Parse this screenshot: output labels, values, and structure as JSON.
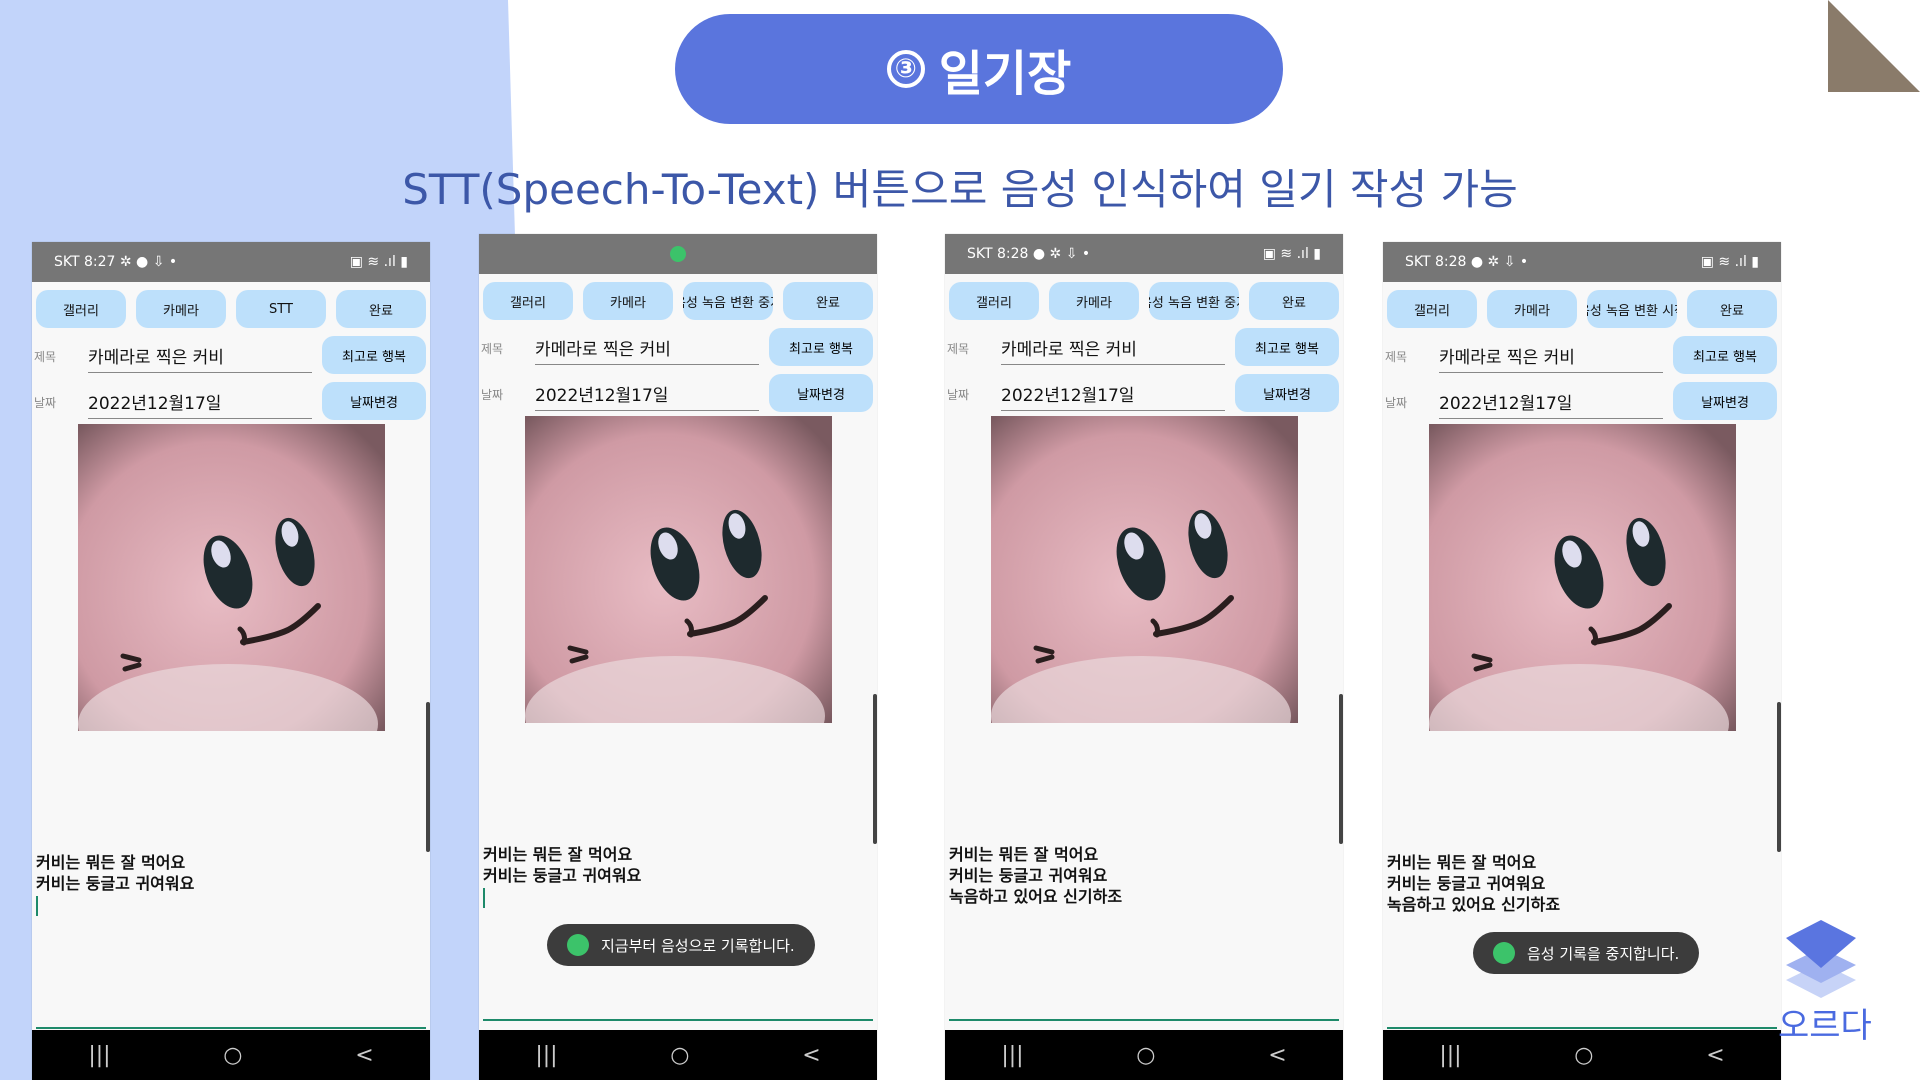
{
  "slide": {
    "step_number": "③",
    "title": "일기장",
    "subtitle": "STT(Speech-To-Text) 버튼으로 음성 인식하여 일기 작성 가능",
    "logo_text": "오르다"
  },
  "labels": {
    "title_label": "제목",
    "date_label": "날짜"
  },
  "nav": {
    "recent": "|||",
    "home": "○",
    "back": "<"
  },
  "phones": [
    {
      "status_left": "SKT 8:27 ✲ ● ⇩ •",
      "status_right": "▣ ≋ .ıl ▮",
      "buttons": [
        "갤러리",
        "카메라",
        "STT",
        "완료"
      ],
      "title_value": "카메라로 찍은 커비",
      "title_button": "최고로 행복",
      "date_value": "2022년12월17일",
      "date_button": "날짜변경",
      "notes": [
        "커비는 뭐든 잘 먹어요",
        "커비는 둥글고 귀여워요"
      ],
      "toast": ""
    },
    {
      "status_left": "",
      "status_right": "",
      "buttons": [
        "갤러리",
        "카메라",
        "음성 녹음 변환 중지",
        "완료"
      ],
      "title_value": "카메라로 찍은 커비",
      "title_button": "최고로 행복",
      "date_value": "2022년12월17일",
      "date_button": "날짜변경",
      "notes": [
        "커비는 뭐든 잘 먹어요",
        "커비는 둥글고 귀여워요"
      ],
      "toast": "지금부터 음성으로 기록합니다."
    },
    {
      "status_left": "SKT 8:28 ● ✲ ⇩ •",
      "status_right": "▣ ≋ .ıl ▮",
      "buttons": [
        "갤러리",
        "카메라",
        "음성 녹음 변환 중지",
        "완료"
      ],
      "title_value": "카메라로 찍은 커비",
      "title_button": "최고로 행복",
      "date_value": "2022년12월17일",
      "date_button": "날짜변경",
      "notes": [
        "커비는 뭐든 잘 먹어요",
        "커비는 둥글고 귀여워요",
        "녹음하고 있어요 신기하조"
      ],
      "toast": ""
    },
    {
      "status_left": "SKT 8:28 ● ✲ ⇩ •",
      "status_right": "▣ ≋ .ıl ▮",
      "buttons": [
        "갤러리",
        "카메라",
        "음성 녹음 변환 시작",
        "완료"
      ],
      "title_value": "카메라로 찍은 커비",
      "title_button": "최고로 행복",
      "date_value": "2022년12월17일",
      "date_button": "날짜변경",
      "notes": [
        "커비는 뭐든 잘 먹어요",
        "커비는 둥글고 귀여워요",
        "녹음하고 있어요 신기하죠"
      ],
      "toast": "음성 기록을 중지합니다."
    }
  ]
}
